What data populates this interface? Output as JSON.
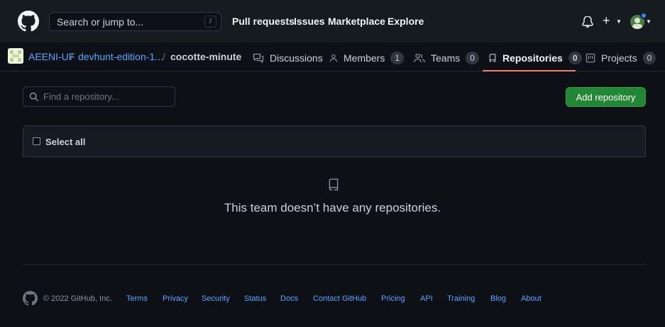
{
  "header": {
    "search_placeholder": "Search or jump to...",
    "search_shortcut": "/",
    "nav": [
      "Pull requests",
      "Issues",
      "Marketplace",
      "Explore"
    ],
    "plus": "+"
  },
  "breadcrumb": {
    "org": "AEENI-UF",
    "sep1": "/",
    "parent": "devhunt-edition-1...",
    "sep2": "/",
    "current": "cocotte-minute"
  },
  "tabs": [
    {
      "label": "Discussions",
      "icon": "comment-discussion-icon"
    },
    {
      "label": "Members",
      "count": "1",
      "icon": "person-icon"
    },
    {
      "label": "Teams",
      "count": "0",
      "icon": "people-icon"
    },
    {
      "label": "Repositories",
      "count": "0",
      "icon": "repo-icon",
      "active": true
    },
    {
      "label": "Projects",
      "count": "0",
      "icon": "project-icon"
    }
  ],
  "toolbar": {
    "find_placeholder": "Find a repository...",
    "add_label": "Add repository"
  },
  "list": {
    "select_all": "Select all"
  },
  "blankslate": {
    "message": "This team doesn’t have any repositories."
  },
  "footer": {
    "copyright": "© 2022 GitHub, Inc.",
    "links": [
      "Terms",
      "Privacy",
      "Security",
      "Status",
      "Docs",
      "Contact GitHub",
      "Pricing",
      "API",
      "Training",
      "Blog",
      "About"
    ]
  },
  "colors": {
    "background": "#0d1117",
    "header": "#161b22",
    "link": "#58a6ff",
    "primary_button": "#238636",
    "active_tab_underline": "#f78166"
  }
}
